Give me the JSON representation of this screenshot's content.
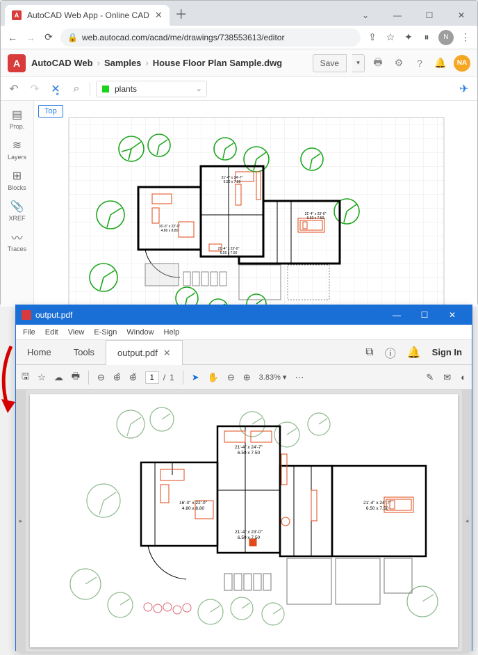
{
  "browser": {
    "tab_title": "AutoCAD Web App - Online CAD",
    "url": "web.autocad.com/acad/me/drawings/738553613/editor",
    "avatar_initial": "N"
  },
  "app": {
    "breadcrumb": [
      "AutoCAD Web",
      "Samples",
      "House Floor Plan Sample.dwg"
    ],
    "save_label": "Save",
    "avatar": "NA",
    "active_layer": "plants",
    "view_label": "Top",
    "sidebar": [
      {
        "label": "Prop."
      },
      {
        "label": "Layers"
      },
      {
        "label": "Blocks"
      },
      {
        "label": "XREF"
      },
      {
        "label": "Traces"
      }
    ],
    "rooms": [
      {
        "dim1": "21'-4\" x 24'-7\"",
        "dim2": "6.50 x 7.50"
      },
      {
        "dim1": "16'-0\" x 22'-0\"",
        "dim2": "4.80 x 8.80"
      },
      {
        "dim1": "21'-4\" x 23'-0\"",
        "dim2": "6.50 x 7.50"
      },
      {
        "dim1": "21'-4\" x 23'-0\"",
        "dim2": "6.50 x 7.50"
      },
      {
        "dim1": "21'-4\" x 24'-7\"",
        "dim2": "6.50 x 7.50"
      }
    ]
  },
  "pdf": {
    "window_title": "output.pdf",
    "menus": [
      "File",
      "Edit",
      "View",
      "E-Sign",
      "Window",
      "Help"
    ],
    "tabs": {
      "home": "Home",
      "tools": "Tools",
      "doc": "output.pdf"
    },
    "sign_in": "Sign In",
    "page_current": "1",
    "page_total": "1",
    "zoom": "3.83%"
  }
}
